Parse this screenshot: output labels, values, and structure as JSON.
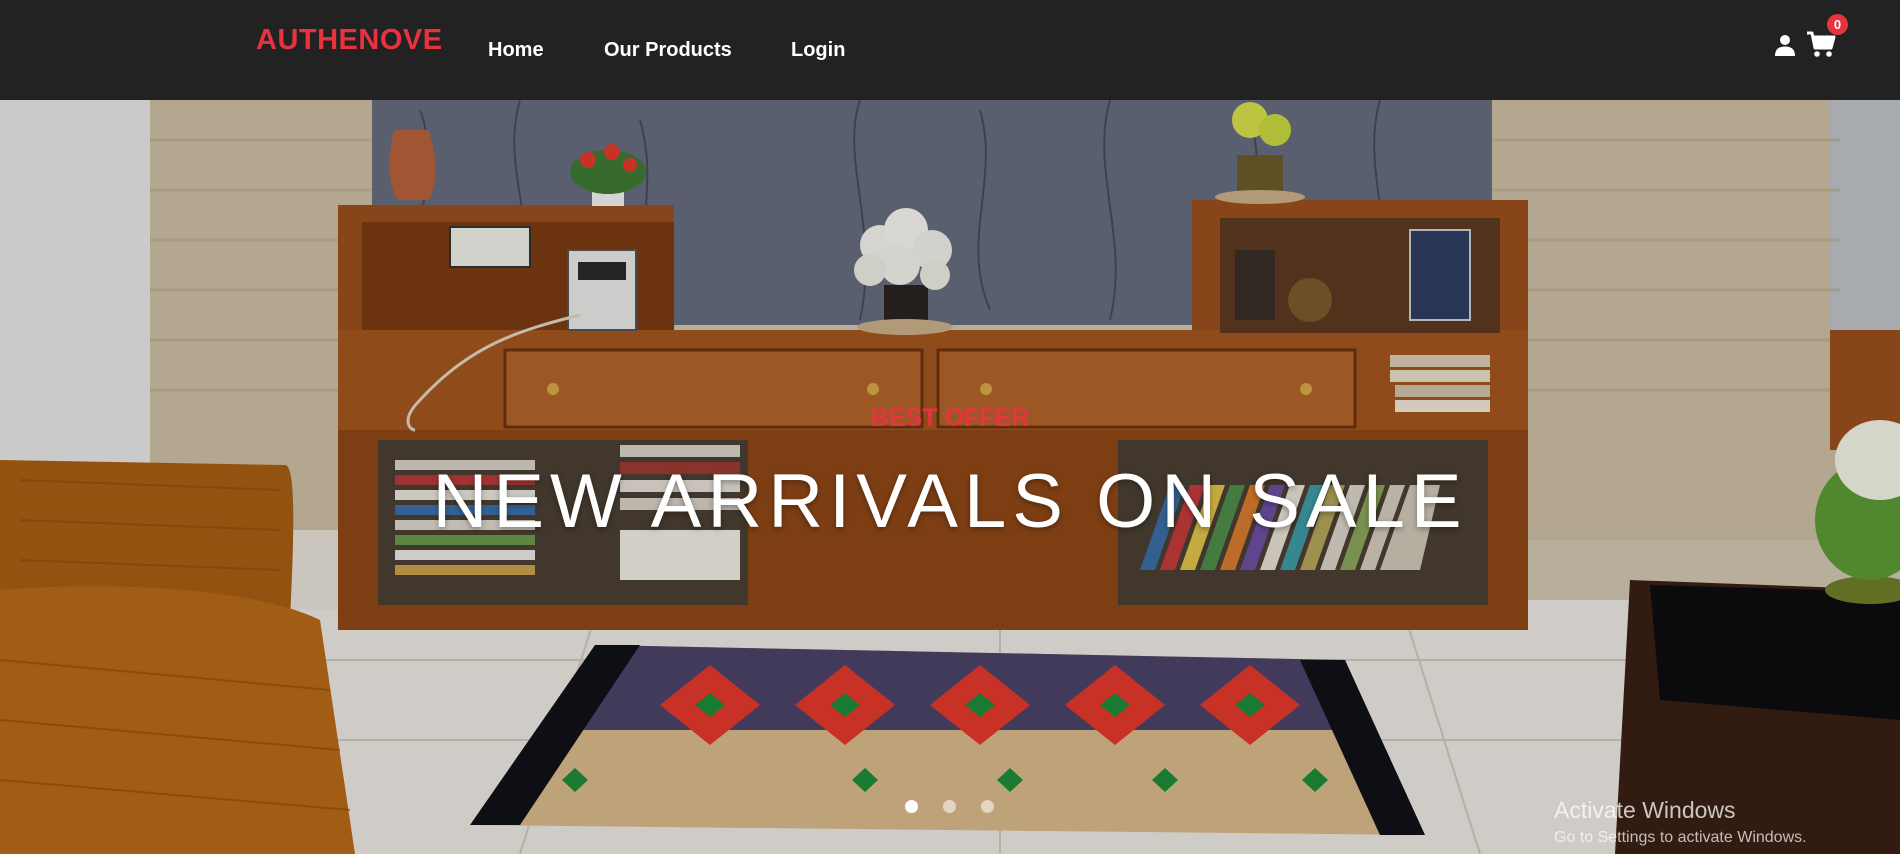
{
  "navbar": {
    "brand": "AUTHENOVE",
    "links": {
      "home": "Home",
      "products": "Our Products",
      "login": "Login"
    },
    "account_icon": "user-icon",
    "cart_icon": "shopping-cart-icon",
    "cart_count": "0"
  },
  "hero": {
    "kicker": "BEST OFFER",
    "title": "NEW ARRIVALS ON SALE",
    "slides": 3,
    "active_slide": 1
  },
  "watermark": {
    "title": "Activate Windows",
    "subtitle": "Go to Settings to activate Windows."
  },
  "colors": {
    "navbar_bg": "#222222",
    "accent": "#e8333f",
    "text_light": "#ffffff"
  }
}
